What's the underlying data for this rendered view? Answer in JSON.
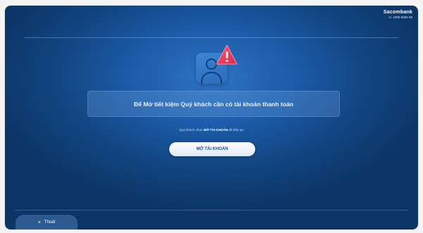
{
  "brand": {
    "name": "Sacombank",
    "phone": "☏ 1900 5555 88"
  },
  "dialog": {
    "message": "Để Mở tiết kiệm Quý khách cần có tài khoản thanh toán",
    "hint_prefix": "Quý khách chọn ",
    "hint_bold": "MỞ TÀI KHOẢN",
    "hint_suffix": " để tiếp tục",
    "open_account_label": "MỞ TÀI KHOẢN"
  },
  "footer": {
    "exit_icon": "×",
    "exit_label": "Thoát"
  },
  "icons": {
    "avatar": "user-avatar-icon",
    "warning": "warning-triangle-icon"
  },
  "colors": {
    "background": "#11447f",
    "accent": "#1b4f95",
    "warning": "#e8395a"
  }
}
